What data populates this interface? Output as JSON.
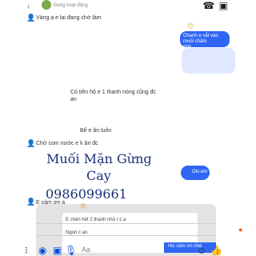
{
  "top": {
    "status_text": "Đang hoạt động",
    "icons": [
      "phone-icon",
      "video-icon",
      "info-icon"
    ]
  },
  "messages": [
    {
      "id": "m1",
      "text": "Vàng ạ e lại đang chờ làm"
    },
    {
      "id": "m2",
      "lines": [
        "Chanh e vắt vào muối chấm",
        "nhé"
      ]
    },
    {
      "id": "m3",
      "text": ""
    },
    {
      "id": "m4",
      "text": "Có tiền hộ e 1 thanh nóng cũng đc an"
    },
    {
      "id": "m5",
      "text": "Bế e ăn luôn"
    },
    {
      "id": "m6",
      "text": "Chờ com nước e k ăn đc"
    },
    {
      "id": "m7",
      "text": "E cảm ơn ạ"
    }
  ],
  "handwritten": {
    "line1": "Muối Mặn Gừng",
    "line2": "Cay",
    "line3": "0986099661"
  },
  "oki_label": "Oki em",
  "note": {
    "inner_line1": "E chén hết 2 thanh nhỏ r c a",
    "inner_line2": "Ngon c an",
    "blue_strip": "Hic cảm ơn nhé"
  },
  "bottom_bar": {
    "icons": [
      "more-icon",
      "camera-icon",
      "photo-icon",
      "mic-icon",
      "text-icon",
      "emoji-icon",
      "like-icon"
    ],
    "text_icon": "Aa"
  },
  "colors": {
    "accent": "#2f66f4",
    "handwriting": "#1a2e77"
  }
}
